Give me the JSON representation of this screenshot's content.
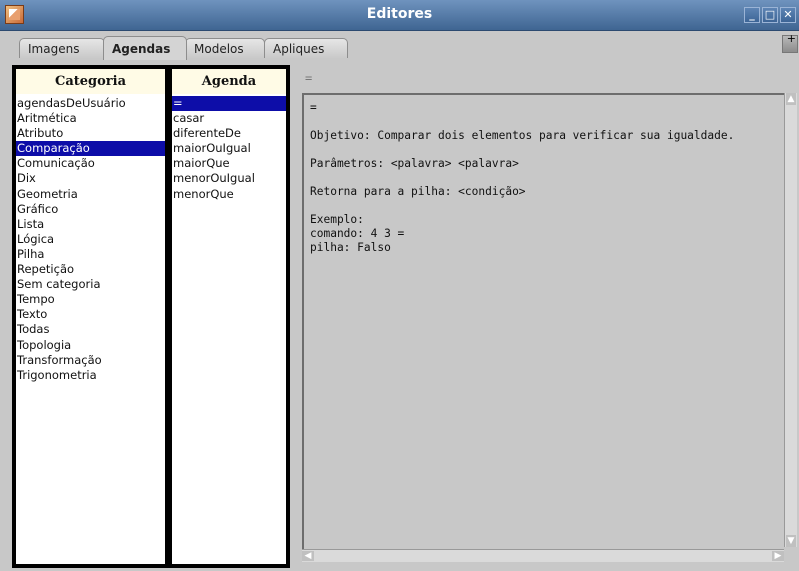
{
  "window": {
    "title": "Editores"
  },
  "tabs": [
    {
      "label": "Imagens",
      "active": false
    },
    {
      "label": "Agendas",
      "active": true
    },
    {
      "label": "Modelos",
      "active": false
    },
    {
      "label": "Apliques",
      "active": false
    }
  ],
  "categoria": {
    "header": "Categoria",
    "items": [
      "agendasDeUsuário",
      "Aritmética",
      "Atributo",
      "Comparação",
      "Comunicação",
      "Dix",
      "Geometria",
      "Gráfico",
      "Lista",
      "Lógica",
      "Pilha",
      "Repetição",
      "Sem categoria",
      "Tempo",
      "Texto",
      "Todas",
      "Topologia",
      "Transformação",
      "Trigonometria"
    ],
    "selected": "Comparação"
  },
  "agenda": {
    "header": "Agenda",
    "items": [
      "=",
      "casar",
      "diferenteDe",
      "maiorOuIgual",
      "maiorQue",
      "menorOuIgual",
      "menorQue"
    ],
    "selected": "="
  },
  "doc": {
    "current_label": "=",
    "lines": [
      "=",
      "",
      "Objetivo: Comparar dois elementos para verificar sua igualdade.",
      "",
      "Parâmetros: <palavra> <palavra>",
      "",
      "Retorna para a pilha: <condição>",
      "",
      "Exemplo:",
      "comando: 4 3 =",
      "pilha: Falso"
    ]
  },
  "colors": {
    "selection": "#0d0da8",
    "header_bg": "#fffbe6",
    "titlebar": "#4f76a6"
  }
}
